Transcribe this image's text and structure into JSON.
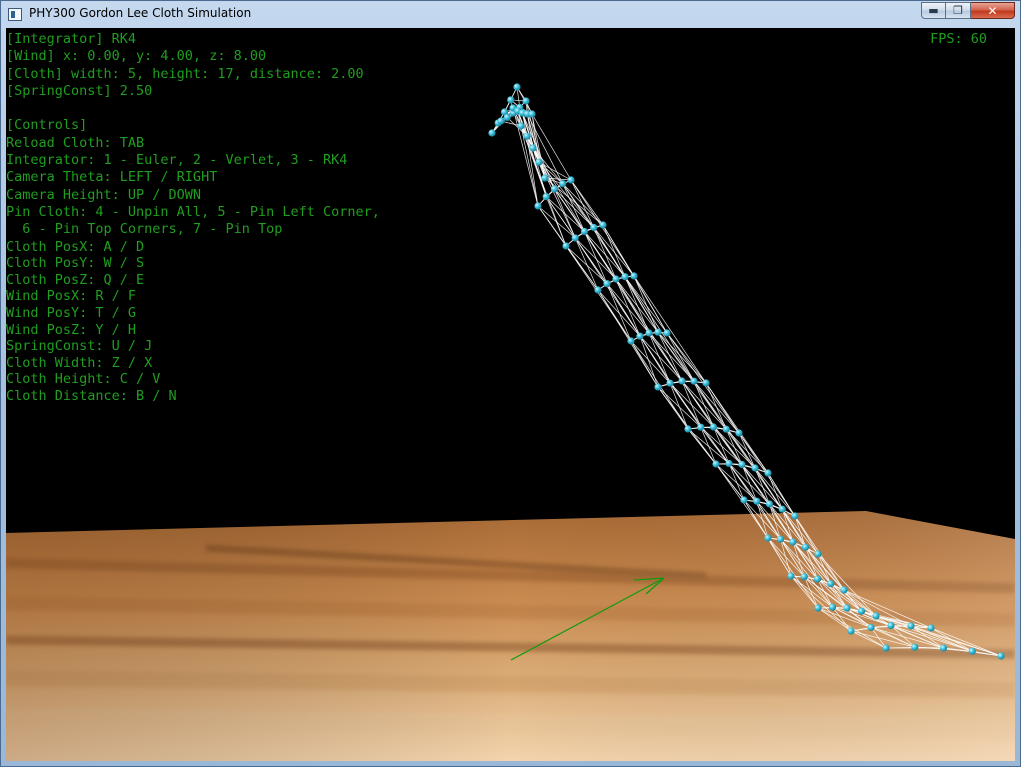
{
  "window": {
    "title": "PHY300 Gordon Lee Cloth Simulation",
    "minimize_label": "▬",
    "maximize_label": "❐",
    "close_label": "✕"
  },
  "hud": {
    "integrator": "[Integrator] RK4",
    "wind": "[Wind] x: 0.00, y: 4.00, z: 8.00",
    "cloth": "[Cloth] width: 5, height: 17, distance: 2.00",
    "spring_const": "[SpringConst] 2.50",
    "controls_header": "[Controls]",
    "controls": [
      "Reload Cloth: TAB",
      "Integrator: 1 - Euler, 2 - Verlet, 3 - RK4",
      "Camera Theta: LEFT / RIGHT",
      "Camera Height: UP / DOWN",
      "Pin Cloth: 4 - Unpin All, 5 - Pin Left Corner,",
      "  6 - Pin Top Corners, 7 - Pin Top",
      "Cloth PosX: A / D",
      "Cloth PosY: W / S",
      "Cloth PosZ: Q / E",
      "Wind PosX: R / F",
      "Wind PosY: T / G",
      "Wind PosZ: Y / H",
      "SpringConst: U / J",
      "Cloth Width: Z / X",
      "Cloth Height: C / V",
      "Cloth Distance: B / N"
    ],
    "fps": "FPS: 60"
  },
  "colors": {
    "hud_text": "#1f9e1f",
    "cloth_node": "#3ec3dd",
    "cloth_spring": "#ffffff",
    "wind_arrow": "#0f9a0f",
    "floor_wood": "#c9874a",
    "background": "#000000"
  },
  "icons": {
    "app": "window-app-icon",
    "minimize": "minimize-icon",
    "maximize": "maximize-icon",
    "close": "close-icon"
  }
}
